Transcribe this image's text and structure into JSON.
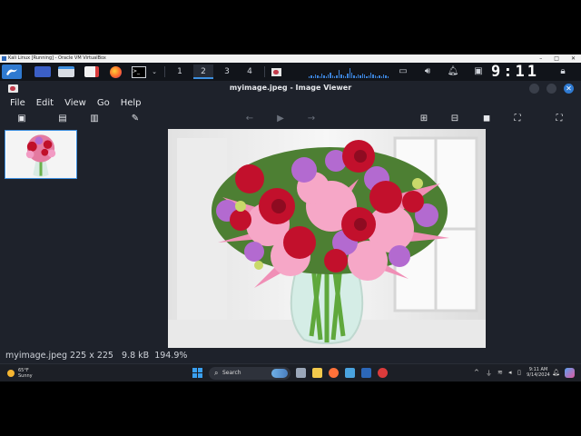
{
  "vbox": {
    "title": "Kali Linux [Running] - Oracle VM VirtualBox",
    "controls": [
      "–",
      "□",
      "✕"
    ]
  },
  "panel": {
    "workspaces": [
      "1",
      "2",
      "3",
      "4"
    ],
    "active_workspace": "2",
    "clock": "9:11"
  },
  "viewer": {
    "title": "myimage.jpeg - Image Viewer",
    "menu": [
      "File",
      "Edit",
      "View",
      "Go",
      "Help"
    ],
    "status": "myimage.jpeg 225 x 225   9.8 kB  194.9%",
    "accent": "#2f7ad1"
  },
  "taskbar": {
    "weather_temp": "65°F",
    "weather_desc": "Sunny",
    "search_label": "Search",
    "time": "9:11 AM",
    "date": "9/14/2024"
  }
}
